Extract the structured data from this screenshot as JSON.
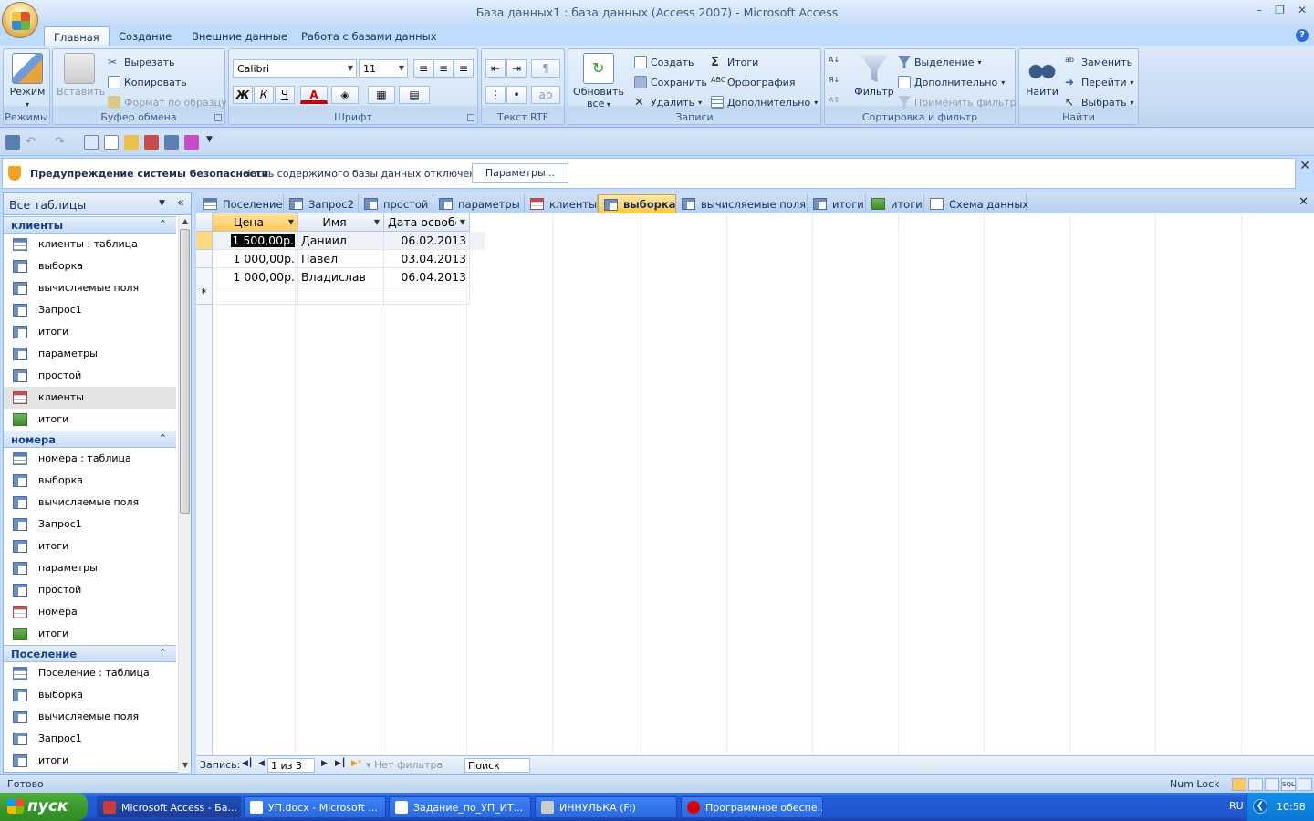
{
  "window": {
    "title": "База данных1 : база данных (Access 2007) - Microsoft Access"
  },
  "ribbon_tabs": [
    "Главная",
    "Создание",
    "Внешние данные",
    "Работа с базами данных"
  ],
  "ribbon": {
    "modes": {
      "view_label": "Режим",
      "group_label": "Режимы"
    },
    "clipboard": {
      "paste_label": "Вставить",
      "cut_label": "Вырезать",
      "copy_label": "Копировать",
      "format_painter_label": "Формат по образцу",
      "group_label": "Буфер обмена"
    },
    "font": {
      "font_name": "Calibri",
      "font_size": "11",
      "bold": "Ж",
      "italic": "К",
      "underline": "Ч",
      "font_color": "A",
      "group_label": "Шрифт"
    },
    "rtf": {
      "group_label": "Текст RTF"
    },
    "records": {
      "refresh_label": "Обновить",
      "refresh_label2": "все",
      "new_label": "Создать",
      "save_label": "Сохранить",
      "delete_label": "Удалить",
      "totals_label": "Итоги",
      "spelling_label": "Орфография",
      "more_label": "Дополнительно",
      "group_label": "Записи"
    },
    "sort_filter": {
      "filter_label": "Фильтр",
      "selection_label": "Выделение",
      "advanced_label": "Дополнительно",
      "toggle_filter_label": "Применить фильтр",
      "group_label": "Сортировка и фильтр"
    },
    "find": {
      "find_label": "Найти",
      "replace_label": "Заменить",
      "goto_label": "Перейти",
      "select_label": "Выбрать",
      "group_label": "Найти"
    }
  },
  "security_bar": {
    "title": "Предупреждение системы безопасности",
    "message": "Часть содержимого базы данных отключено",
    "button": "Параметры..."
  },
  "nav_pane": {
    "header": "Все таблицы",
    "groups": [
      {
        "title": "клиенты",
        "items": [
          {
            "label": "клиенты : таблица",
            "icon": "table-icon"
          },
          {
            "label": "выборка",
            "icon": "query-icon"
          },
          {
            "label": "вычисляемые поля",
            "icon": "query-icon"
          },
          {
            "label": "Запрос1",
            "icon": "query-icon"
          },
          {
            "label": "итоги",
            "icon": "query-icon"
          },
          {
            "label": "параметры",
            "icon": "query-icon"
          },
          {
            "label": "простой",
            "icon": "query-icon"
          },
          {
            "label": "клиенты",
            "icon": "form-icon"
          },
          {
            "label": "итоги",
            "icon": "report-icon"
          }
        ]
      },
      {
        "title": "номера",
        "items": [
          {
            "label": "номера : таблица",
            "icon": "table-icon"
          },
          {
            "label": "выборка",
            "icon": "query-icon"
          },
          {
            "label": "вычисляемые поля",
            "icon": "query-icon"
          },
          {
            "label": "Запрос1",
            "icon": "query-icon"
          },
          {
            "label": "итоги",
            "icon": "query-icon"
          },
          {
            "label": "параметры",
            "icon": "query-icon"
          },
          {
            "label": "простой",
            "icon": "query-icon"
          },
          {
            "label": "номера",
            "icon": "form-icon"
          },
          {
            "label": "итоги",
            "icon": "report-icon"
          }
        ]
      },
      {
        "title": "Поселение",
        "items": [
          {
            "label": "Поселение : таблица",
            "icon": "table-icon"
          },
          {
            "label": "выборка",
            "icon": "query-icon"
          },
          {
            "label": "вычисляемые поля",
            "icon": "query-icon"
          },
          {
            "label": "Запрос1",
            "icon": "query-icon"
          },
          {
            "label": "итоги",
            "icon": "query-icon"
          }
        ]
      }
    ]
  },
  "doc_tabs": [
    {
      "label": "Поселение",
      "icon": "table-icon"
    },
    {
      "label": "Запрос2",
      "icon": "query-icon"
    },
    {
      "label": "простой",
      "icon": "query-icon"
    },
    {
      "label": "параметры",
      "icon": "query-icon"
    },
    {
      "label": "клиенты",
      "icon": "form-icon"
    },
    {
      "label": "выборка",
      "icon": "query-icon",
      "active": true
    },
    {
      "label": "вычисляемые поля",
      "icon": "query-icon"
    },
    {
      "label": "итоги",
      "icon": "query-icon"
    },
    {
      "label": "итоги",
      "icon": "report-icon"
    },
    {
      "label": "Схема данных",
      "icon": "relationships-icon"
    }
  ],
  "datasheet": {
    "columns": [
      "Цена",
      "Имя",
      "Дата освобо"
    ],
    "rows": [
      [
        "1 500,00р.",
        "Даниил",
        "06.02.2013"
      ],
      [
        "1 000,00р.",
        "Павел",
        "03.04.2013"
      ],
      [
        "1 000,00р.",
        "Владислав",
        "06.04.2013"
      ]
    ],
    "new_row_marker": "*"
  },
  "record_nav": {
    "label": "Запись:",
    "position": "1 из 3",
    "filter": "Нет фильтра",
    "search": "Поиск"
  },
  "status": {
    "text": "Готово",
    "numlock": "Num Lock"
  },
  "taskbar": {
    "start": "пуск",
    "tasks": [
      "Microsoft Access - Ба...",
      "УП.docx - Microsoft ...",
      "Задание_по_УП_ИТ...",
      "ИННУЛЬКА (F:)",
      "Программное обеспе..."
    ],
    "lang": "RU",
    "clock": "10:58"
  },
  "colors": {
    "ribbon_bg": "#bfdbff",
    "active_tab": "#ffc74e",
    "taskbar": "#245edb",
    "start": "#3a9a2d"
  }
}
